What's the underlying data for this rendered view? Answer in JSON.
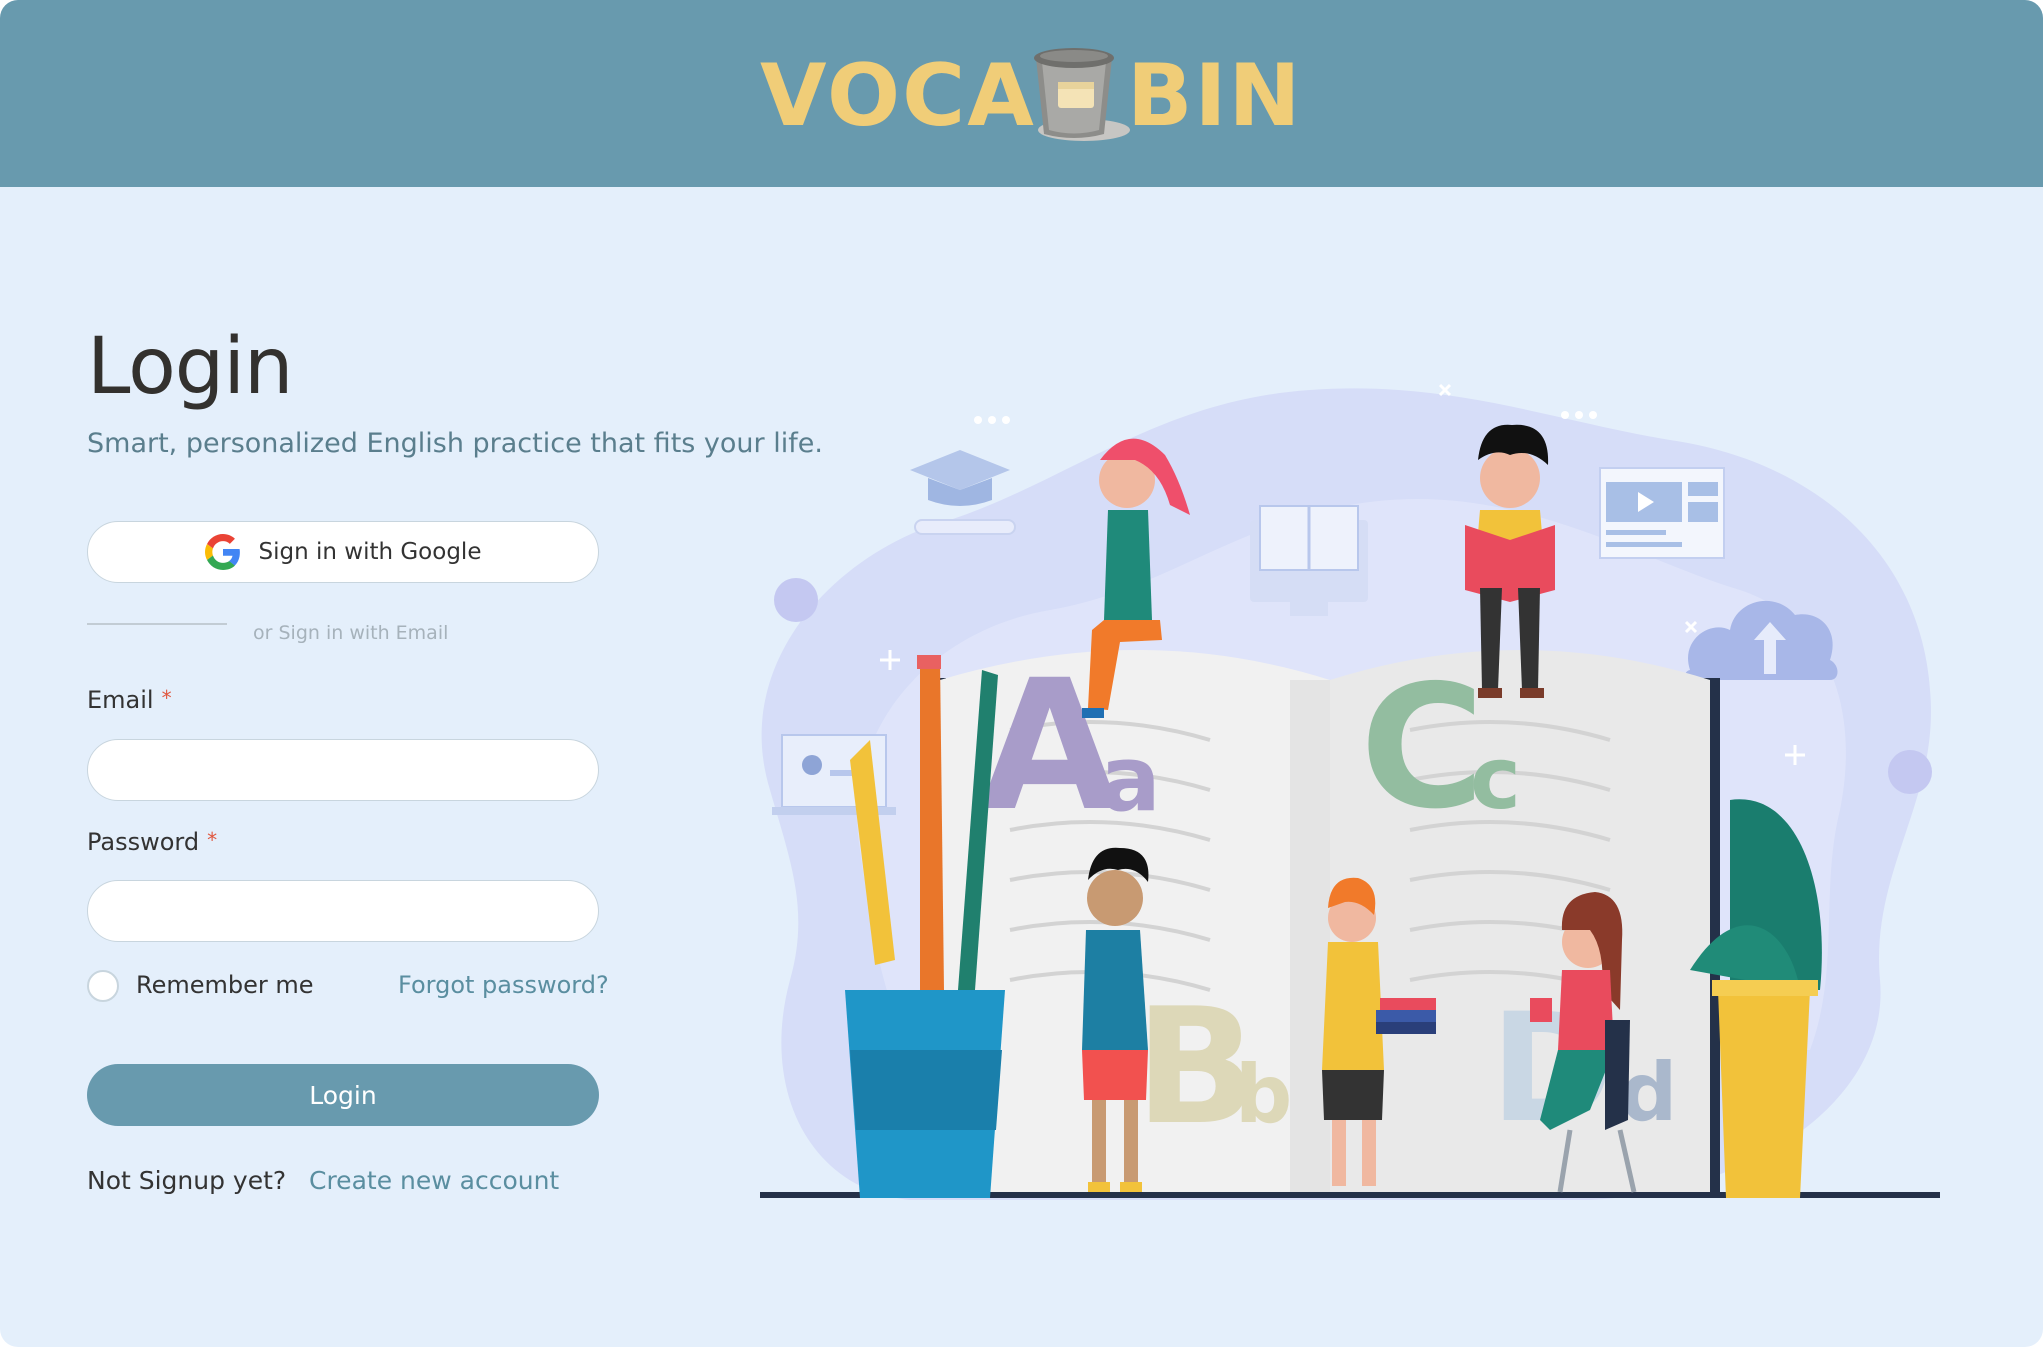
{
  "header": {
    "logo": {
      "left_text": "VOCA",
      "right_text": "BIN",
      "icon": "trash-bin-icon"
    }
  },
  "login": {
    "title": "Login",
    "subtitle": "Smart, personalized English practice that fits your life.",
    "google_button": {
      "label": "Sign in with Google",
      "icon": "google-icon"
    },
    "divider_text": "or Sign in with Email",
    "email": {
      "label": "Email",
      "required_mark": "*",
      "value": "",
      "placeholder": ""
    },
    "password": {
      "label": "Password",
      "required_mark": "*",
      "value": "",
      "placeholder": ""
    },
    "remember_label": "Remember me",
    "forgot_link": "Forgot password?",
    "login_button": "Login",
    "signup_prompt": "Not Signup yet?",
    "signup_link": "Create new account"
  },
  "illustration": {
    "letters": [
      "A",
      "a",
      "B",
      "b",
      "C",
      "c",
      "D",
      "d"
    ]
  },
  "colors": {
    "header_bg": "#689aae",
    "page_bg": "#e4effb",
    "logo_yellow": "#f0cd78",
    "accent": "#689aae",
    "link": "#5a8ea0",
    "required": "#e0573f"
  }
}
